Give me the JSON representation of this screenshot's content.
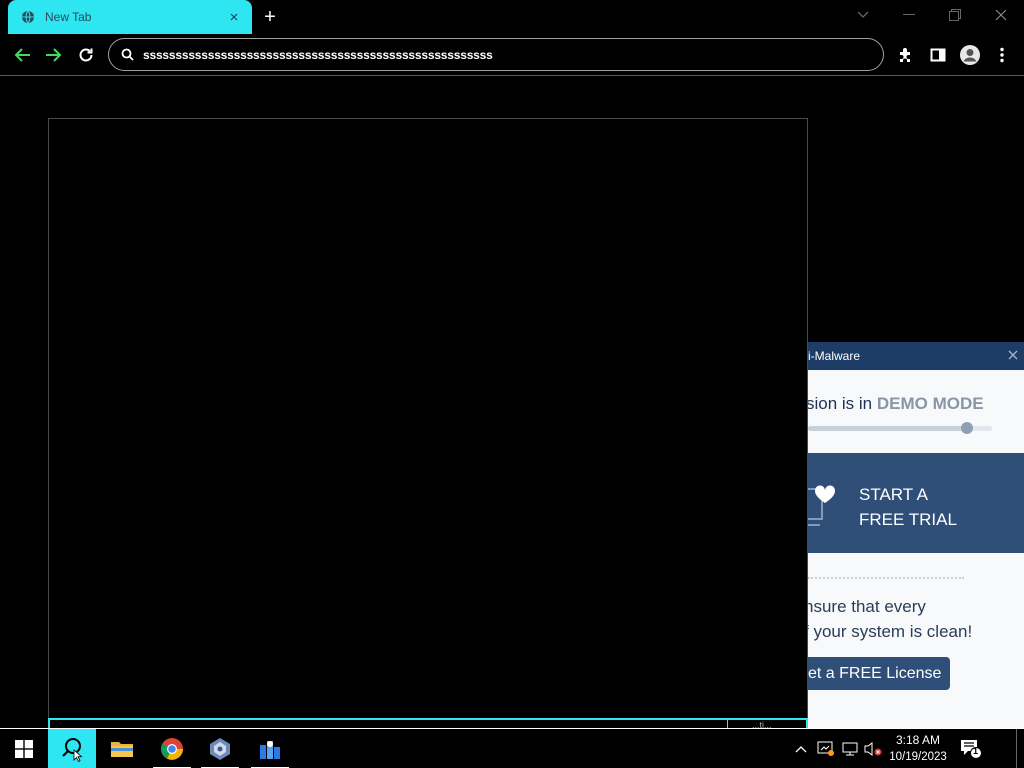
{
  "browser": {
    "tab": {
      "title": "New Tab",
      "favicon": "globe-icon",
      "close_glyph": "×"
    },
    "new_tab_glyph": "+",
    "address_bar": {
      "value": "ssssssssssssssssssssssssssssssssssssssssssssssssssssss"
    },
    "colors": {
      "tab_active": "#2ee6f2",
      "nav_arrow": "#3ddc5a"
    }
  },
  "popup": {
    "header": "i-Malware",
    "demo_prefix": "sion is in ",
    "demo_mode": "DEMO MODE",
    "trial_line1": "START A",
    "trial_line2": "FREE TRIAL",
    "ensure_line1": "nsure that every",
    "ensure_line2": "f your system is clean!",
    "license_button": "et a FREE License",
    "colors": {
      "header": "#1e3d66",
      "trial_bg": "#2f4f79"
    }
  },
  "taskbar": {
    "clock_time": "3:18 AM",
    "clock_date": "10/19/2023",
    "notifications_count": "1",
    "bottom_strip_text": "...ti..."
  }
}
